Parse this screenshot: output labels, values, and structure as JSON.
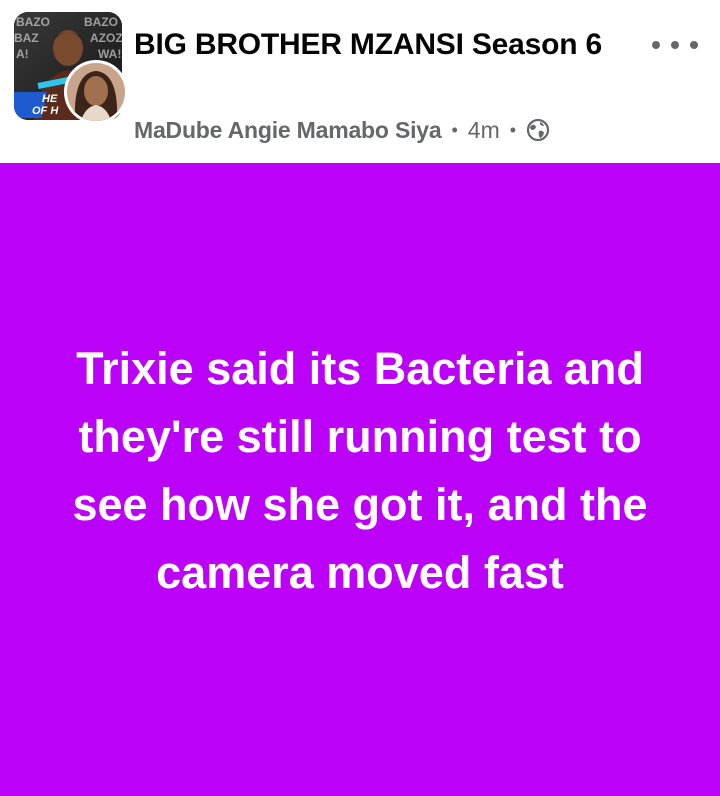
{
  "header": {
    "group_name": "BIG BROTHER MZANSI Season 6",
    "author": "MaDube Angie Mamabo Siya",
    "separator": "•",
    "time_ago": "4m",
    "visibility_icon": "globe-icon",
    "more_icon": "more-options-icon"
  },
  "post": {
    "text": "Trixie said its Bacteria and they're still running test to see how she got it, and the camera moved fast",
    "background_color": "#bc01f8",
    "text_color": "#ffffff"
  }
}
